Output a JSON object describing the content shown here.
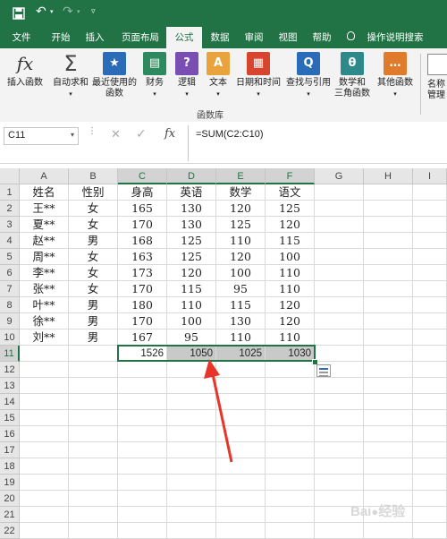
{
  "tabs": [
    "文件",
    "开始",
    "插入",
    "页面布局",
    "公式",
    "数据",
    "审阅",
    "视图",
    "帮助",
    "操作说明搜索"
  ],
  "ribbon": {
    "buttons": [
      {
        "label": "插入函数",
        "icon": "fx"
      },
      {
        "label": "自动求和",
        "icon": "Σ"
      },
      {
        "label": "最近使用的",
        "label2": "函数",
        "icon": "★"
      },
      {
        "label": "财务",
        "icon": "▤"
      },
      {
        "label": "逻辑",
        "icon": "?"
      },
      {
        "label": "文本",
        "icon": "A"
      },
      {
        "label": "日期和时间",
        "icon": "▦"
      },
      {
        "label": "查找与引用",
        "icon": "Q"
      },
      {
        "label": "数学和",
        "label2": "三角函数",
        "icon": "θ"
      },
      {
        "label": "其他函数",
        "icon": "…"
      },
      {
        "label": "名称",
        "label2": "管理",
        "icon": ""
      }
    ],
    "group_label": "函数库"
  },
  "formula_bar": {
    "name_box": "C11",
    "fx": "fx",
    "formula": "=SUM(C2:C10)"
  },
  "columns": [
    "A",
    "B",
    "C",
    "D",
    "E",
    "F",
    "G",
    "H",
    "I"
  ],
  "rows": [
    "1",
    "2",
    "3",
    "4",
    "5",
    "6",
    "7",
    "8",
    "9",
    "10",
    "11",
    "12",
    "13",
    "14",
    "15",
    "16",
    "17",
    "18",
    "19",
    "20",
    "21",
    "22"
  ],
  "table": {
    "headers": [
      "姓名",
      "性别",
      "身高",
      "英语",
      "数学",
      "语文"
    ],
    "records": [
      [
        "王**",
        "女",
        "165",
        "130",
        "120",
        "125"
      ],
      [
        "夏**",
        "女",
        "170",
        "130",
        "125",
        "120"
      ],
      [
        "赵**",
        "男",
        "168",
        "125",
        "110",
        "115"
      ],
      [
        "周**",
        "女",
        "163",
        "125",
        "120",
        "100"
      ],
      [
        "李**",
        "女",
        "173",
        "120",
        "100",
        "110"
      ],
      [
        "张**",
        "女",
        "170",
        "115",
        "95",
        "110"
      ],
      [
        "叶**",
        "男",
        "180",
        "110",
        "115",
        "120"
      ],
      [
        "徐**",
        "男",
        "170",
        "100",
        "130",
        "120"
      ],
      [
        "刘**",
        "男",
        "167",
        "95",
        "110",
        "110"
      ]
    ],
    "sums": [
      "1526",
      "1050",
      "1025",
      "1030"
    ]
  },
  "colors": {
    "brand": "#217346",
    "arrow": "#e8352a"
  }
}
